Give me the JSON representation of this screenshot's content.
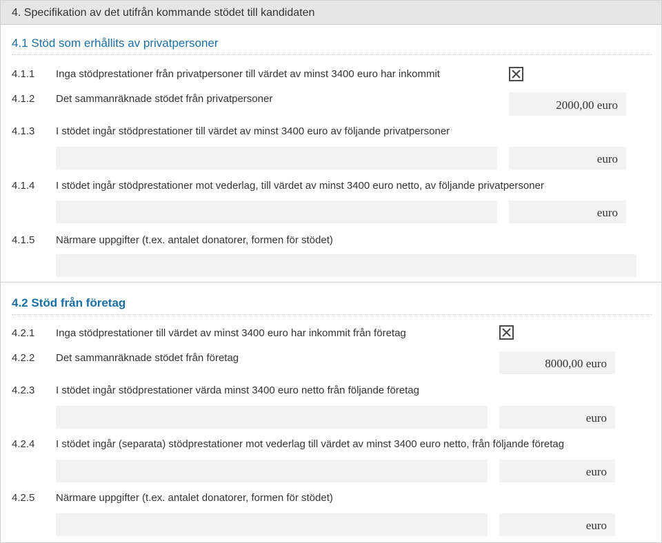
{
  "header": {
    "title": "4. Specifikation av det utifrån kommande stödet till kandidaten"
  },
  "sub1": {
    "title": "4.1 Stöd som erhållits av privatpersoner",
    "rows": [
      {
        "num": "4.1.1",
        "label": "Inga stödprestationer från privatpersoner till värdet av minst 3400 euro har inkommit"
      },
      {
        "num": "4.1.2",
        "label": "Det sammanräknade stödet från privatpersoner"
      },
      {
        "num": "4.1.3",
        "label": "I stödet ingår stödprestationer till värdet av minst 3400 euro av följande privatpersoner"
      },
      {
        "num": "4.1.4",
        "label": "I stödet ingår stödprestationer mot vederlag, till värdet av minst 3400 euro netto, av följande privatpersoner"
      },
      {
        "num": "4.1.5",
        "label": "Närmare uppgifter (t.ex. antalet donatorer, formen för stödet)"
      }
    ],
    "total": "2000,00 euro",
    "unit_1_3": "euro",
    "unit_1_4": "euro"
  },
  "sub2": {
    "title": "4.2 Stöd från företag",
    "rows": [
      {
        "num": "4.2.1",
        "label": "Inga stödprestationer till värdet av minst 3400 euro har inkommit från företag"
      },
      {
        "num": "4.2.2",
        "label": "Det sammanräknade stödet från företag"
      },
      {
        "num": "4.2.3",
        "label": "I stödet ingår stödprestationer värda minst 3400 euro netto från följande företag"
      },
      {
        "num": "4.2.4",
        "label": "I stödet ingår (separata) stödprestationer mot vederlag till värdet av minst 3400 euro netto, från följande företag"
      },
      {
        "num": "4.2.5",
        "label": "Närmare uppgifter (t.ex. antalet donatorer, formen för stödet)"
      }
    ],
    "total": "8000,00 euro",
    "unit_2_3": "euro",
    "unit_2_4": "euro",
    "unit_2_5": "euro"
  },
  "checkbox_icon": "checked-box-icon"
}
